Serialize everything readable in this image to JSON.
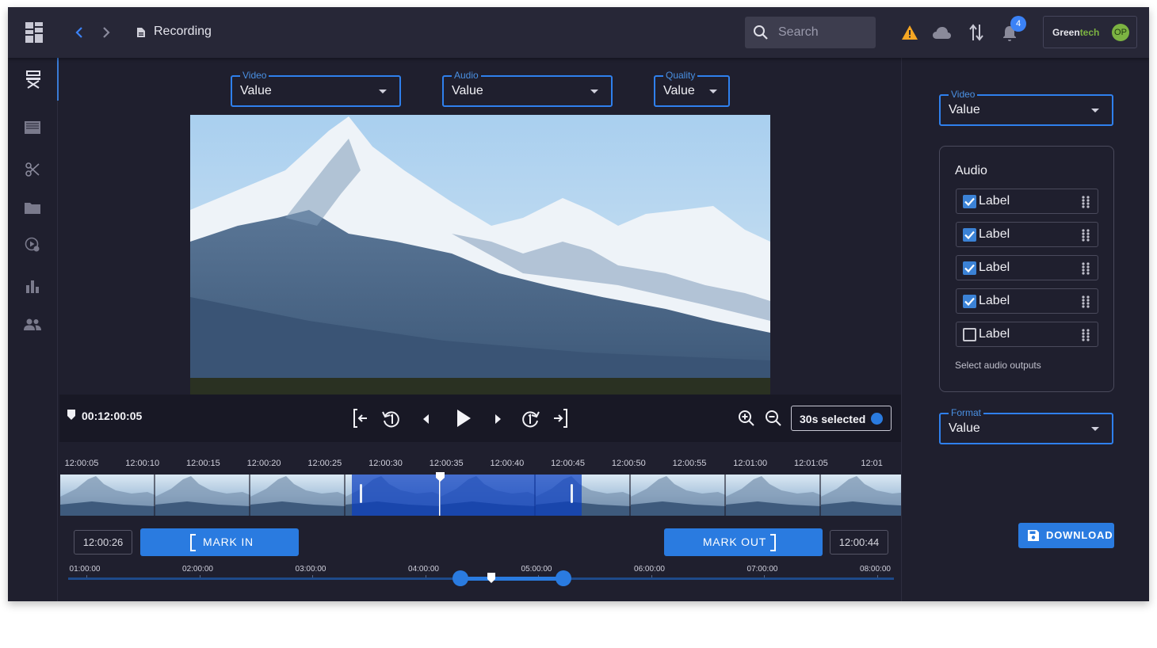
{
  "header": {
    "title": "Recording",
    "search_placeholder": "Search",
    "notification_count": "4",
    "brand_green": "Green",
    "brand_tech": "tech",
    "avatar_initials": "OP",
    "colors": {
      "accent": "#2f80ed",
      "warning": "#f5a623",
      "badge": "#3b82f6",
      "brand_green": "#7cb342"
    }
  },
  "sidebar": {
    "items": [
      {
        "icon": "director-chair-icon",
        "active": true
      },
      {
        "icon": "clapperboard-icon",
        "active": false
      },
      {
        "icon": "scissors-icon",
        "active": false
      },
      {
        "icon": "folder-icon",
        "active": false
      },
      {
        "icon": "media-settings-icon",
        "active": false
      },
      {
        "icon": "bar-chart-icon",
        "active": false
      },
      {
        "icon": "people-icon",
        "active": false
      }
    ]
  },
  "selectors": {
    "video": {
      "label": "Video",
      "value": "Value"
    },
    "audio": {
      "label": "Audio",
      "value": "Value"
    },
    "quality": {
      "label": "Quality",
      "value": "Value"
    }
  },
  "player": {
    "current_time": "00:12:00:05",
    "selection_badge": "30s selected"
  },
  "timeline": {
    "ticks": [
      "12:00:05",
      "12:00:10",
      "12:00:15",
      "12:00:20",
      "12:00:25",
      "12:00:30",
      "12:00:35",
      "12:00:40",
      "12:00:45",
      "12:00:50",
      "12:00:55",
      "12:01:00",
      "12:01:05",
      "12:01"
    ],
    "mark_in_time": "12:00:26",
    "mark_in_label": "MARK IN",
    "mark_out_label": "MARK OUT",
    "mark_out_time": "12:00:44",
    "overview_ticks": [
      "01:00:00",
      "02:00:00",
      "03:00:00",
      "04:00:00",
      "05:00:00",
      "06:00:00",
      "07:00:00",
      "08:00:00"
    ]
  },
  "right_panel": {
    "video": {
      "label": "Video",
      "value": "Value"
    },
    "audio": {
      "title": "Audio",
      "items": [
        {
          "label": "Label",
          "checked": true
        },
        {
          "label": "Label",
          "checked": true
        },
        {
          "label": "Label",
          "checked": true
        },
        {
          "label": "Label",
          "checked": true
        },
        {
          "label": "Label",
          "checked": false
        }
      ],
      "hint": "Select audio outputs"
    },
    "format": {
      "label": "Format",
      "value": "Value"
    },
    "download_label": "DOWNLOAD"
  }
}
